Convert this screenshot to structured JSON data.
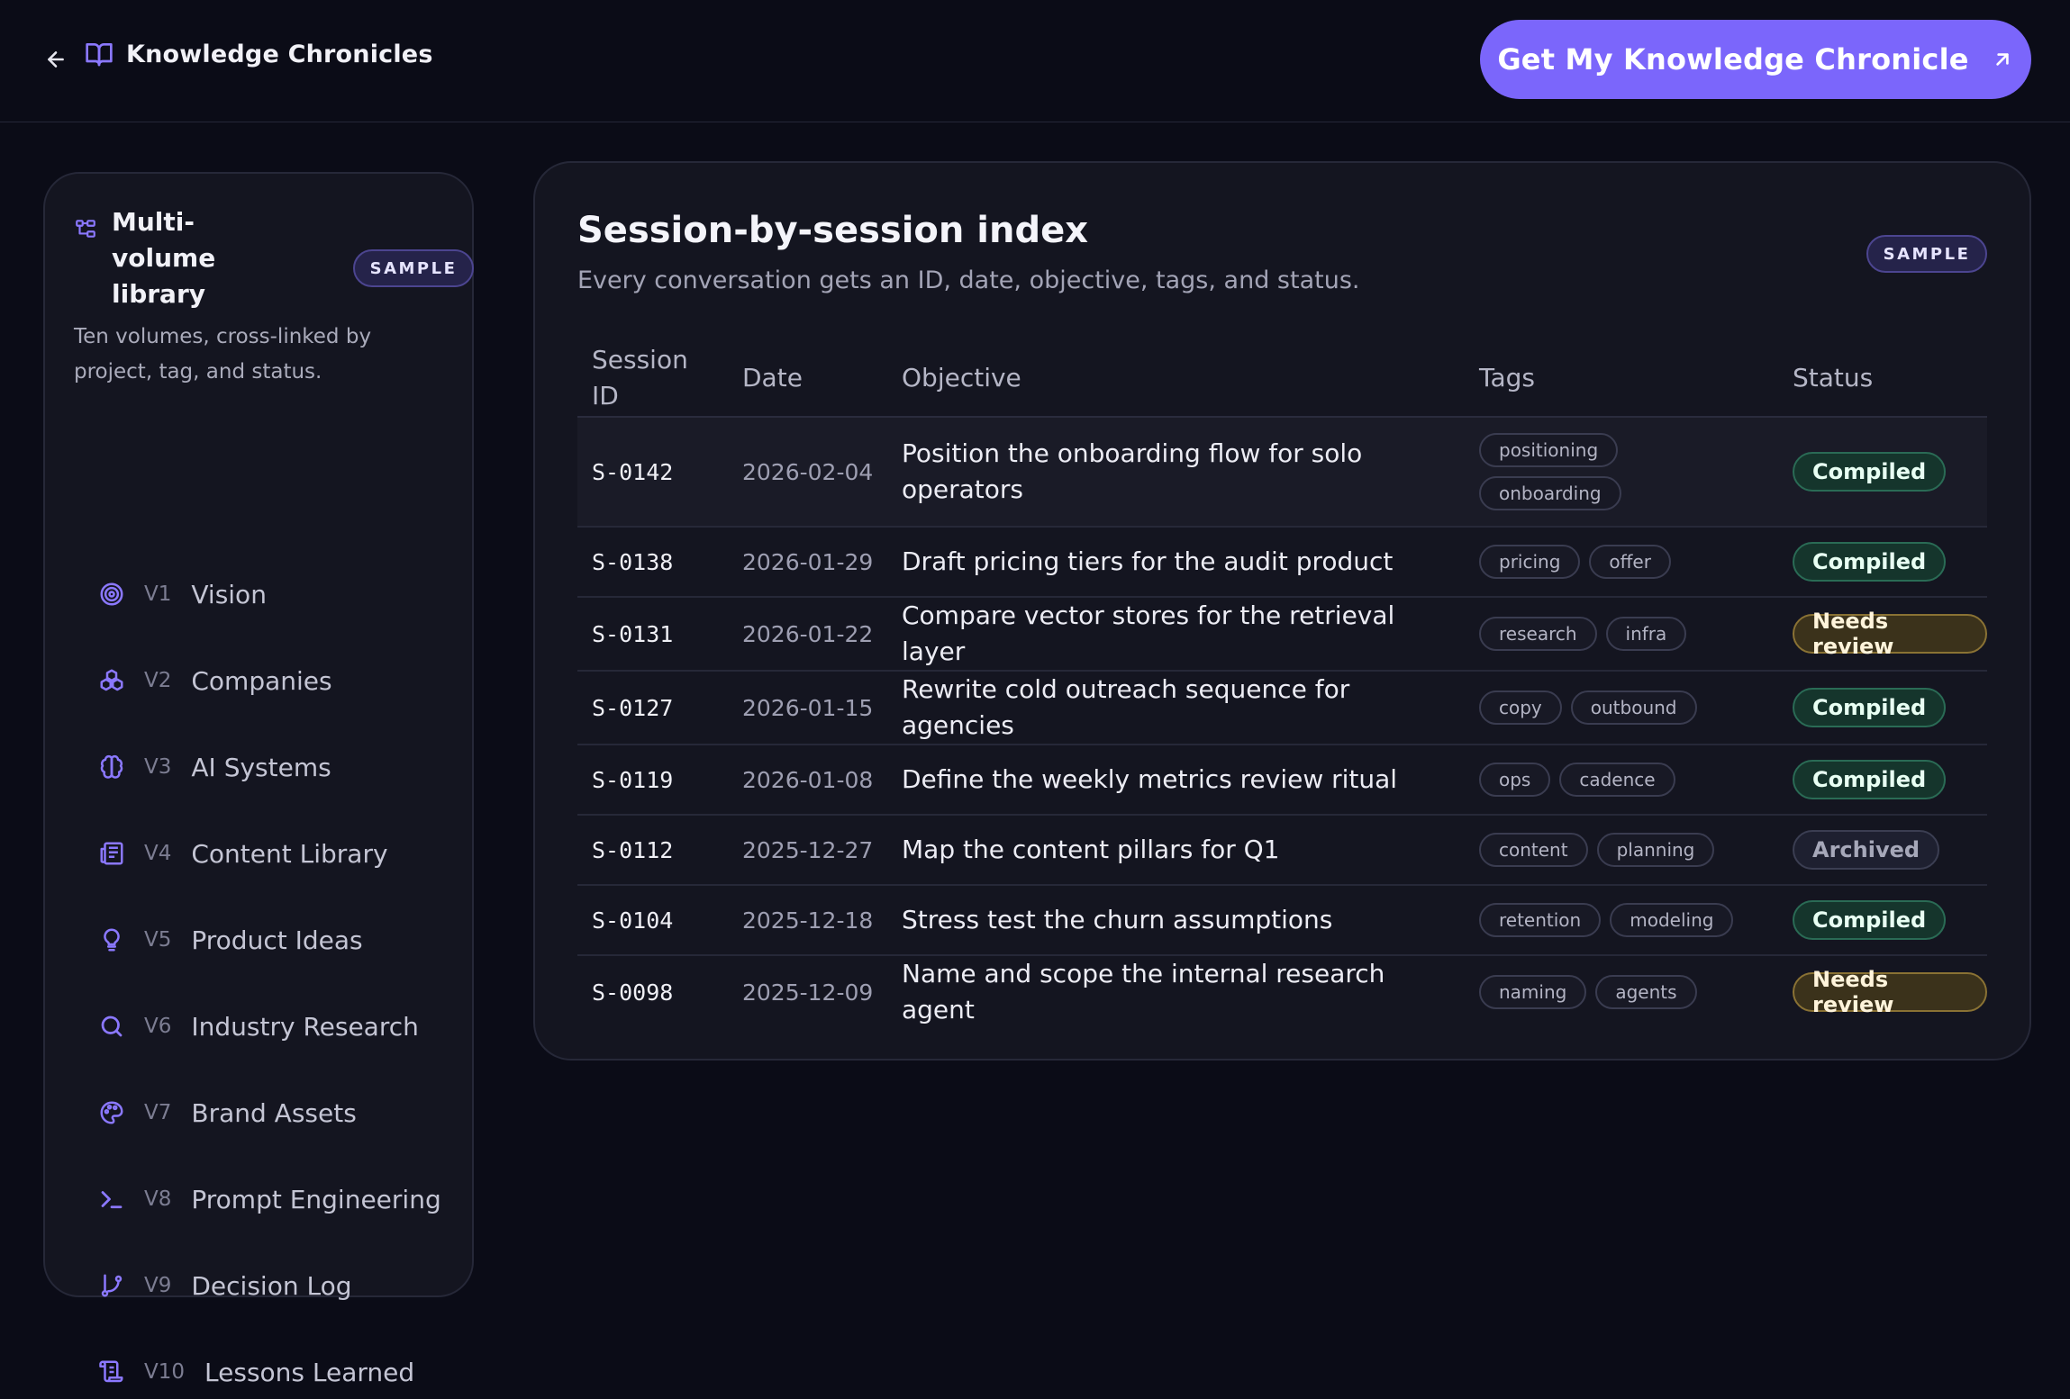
{
  "header": {
    "title": "Knowledge Chronicles",
    "cta_label": "Get My Knowledge Chronicle",
    "icons": [
      "arrow-left-icon",
      "book-icon",
      "arrow-up-right-icon"
    ]
  },
  "sidebar": {
    "title": "Multi-volume library",
    "badge": "SAMPLE",
    "description": "Ten volumes, cross-linked by project, tag, and status.",
    "volumes": [
      {
        "code": "V1",
        "name": "Vision",
        "icon": "target-icon"
      },
      {
        "code": "V2",
        "name": "Companies",
        "icon": "boxes-icon"
      },
      {
        "code": "V3",
        "name": "AI Systems",
        "icon": "brain-icon"
      },
      {
        "code": "V4",
        "name": "Content Library",
        "icon": "newspaper-icon"
      },
      {
        "code": "V5",
        "name": "Product Ideas",
        "icon": "lightbulb-icon"
      },
      {
        "code": "V6",
        "name": "Industry Research",
        "icon": "search-icon"
      },
      {
        "code": "V7",
        "name": "Brand Assets",
        "icon": "palette-icon"
      },
      {
        "code": "V8",
        "name": "Prompt Engineering",
        "icon": "terminal-icon"
      },
      {
        "code": "V9",
        "name": "Decision Log",
        "icon": "git-branch-icon"
      },
      {
        "code": "V10",
        "name": "Lessons Learned",
        "icon": "scroll-icon"
      }
    ]
  },
  "panel": {
    "title": "Session-by-session index",
    "subtitle": "Every conversation gets an ID, date, objective, tags, and status.",
    "badge": "SAMPLE",
    "columns": {
      "id": "Session ID",
      "date": "Date",
      "objective": "Objective",
      "tags": "Tags",
      "status": "Status"
    },
    "rows": [
      {
        "id": "S-0142",
        "date": "2026-02-04",
        "objective": "Position the onboarding flow for solo operators",
        "tags": [
          "positioning",
          "onboarding"
        ],
        "status": "Compiled"
      },
      {
        "id": "S-0138",
        "date": "2026-01-29",
        "objective": "Draft pricing tiers for the audit product",
        "tags": [
          "pricing",
          "offer"
        ],
        "status": "Compiled"
      },
      {
        "id": "S-0131",
        "date": "2026-01-22",
        "objective": "Compare vector stores for the retrieval layer",
        "tags": [
          "research",
          "infra"
        ],
        "status": "Needs review"
      },
      {
        "id": "S-0127",
        "date": "2026-01-15",
        "objective": "Rewrite cold outreach sequence for agencies",
        "tags": [
          "copy",
          "outbound"
        ],
        "status": "Compiled"
      },
      {
        "id": "S-0119",
        "date": "2026-01-08",
        "objective": "Define the weekly metrics review ritual",
        "tags": [
          "ops",
          "cadence"
        ],
        "status": "Compiled"
      },
      {
        "id": "S-0112",
        "date": "2025-12-27",
        "objective": "Map the content pillars for Q1",
        "tags": [
          "content",
          "planning"
        ],
        "status": "Archived"
      },
      {
        "id": "S-0104",
        "date": "2025-12-18",
        "objective": "Stress test the churn assumptions",
        "tags": [
          "retention",
          "modeling"
        ],
        "status": "Compiled"
      },
      {
        "id": "S-0098",
        "date": "2025-12-09",
        "objective": "Name and scope the internal research agent",
        "tags": [
          "naming",
          "agents"
        ],
        "status": "Needs review"
      }
    ]
  },
  "colors": {
    "accent": "#7b66fb",
    "compiled": "#2a6b55",
    "needs_review": "#8a7234",
    "archived": "#3b3e52"
  }
}
